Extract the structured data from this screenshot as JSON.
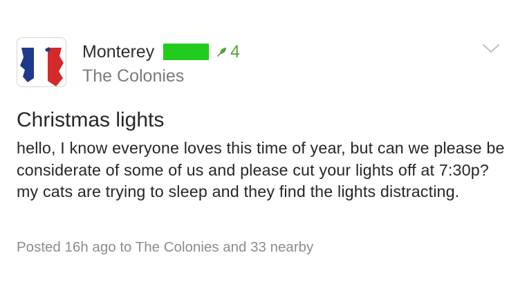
{
  "post": {
    "author": "Monterey",
    "score": "4",
    "neighborhood": "The Colonies",
    "title": "Christmas lights",
    "body": "hello, I know everyone loves this time of year, but can we please be considerate of some of us and please cut your lights off at 7:30p? my cats are trying to sleep and they find the lights distracting.",
    "meta": "Posted 16h ago to The Colonies and 33 nearby"
  },
  "icons": {
    "avatar": "french-flag-map-avatar",
    "score": "leaf-icon",
    "menu": "chevron-down-icon"
  },
  "colors": {
    "redaction": "#22cc1e",
    "score": "#5aa33c",
    "flag_blue": "#1f3a8a",
    "flag_red": "#d42a2a",
    "text": "#262626",
    "muted": "#8c8c8c"
  }
}
